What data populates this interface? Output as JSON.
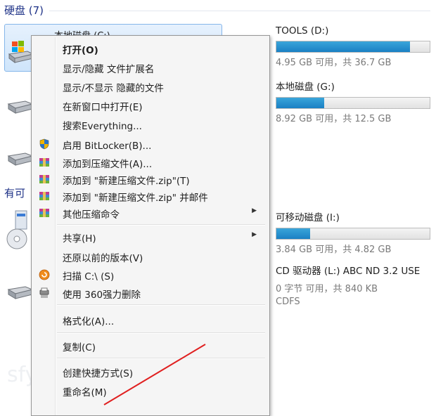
{
  "group_hard_drives": "硬盘 (7)",
  "group_removable_partial": "有可",
  "selected_drive": {
    "name": "本地磁盘 (C:)"
  },
  "drives": [
    {
      "name": "TOOLS (D:)",
      "free": "4.95 GB 可用，共 36.7 GB",
      "usage": 0.87
    },
    {
      "name": "本地磁盘 (G:)",
      "free": "8.92 GB 可用，共 12.5 GB",
      "usage": 0.31
    },
    {
      "name": "可移动磁盘 (I:)",
      "free": "3.84 GB 可用，共 4.82 GB",
      "usage": 0.22
    },
    {
      "name": "CD 驱动器 (L:) ABC ND 3.2 USE",
      "free": "0 字节 可用，共 840 KB",
      "fs": "CDFS"
    }
  ],
  "context_menu": {
    "open": "打开(O)",
    "toggle_ext": "显示/隐藏 文件扩展名",
    "toggle_hidden": "显示/不显示 隐藏的文件",
    "open_new_window": "在新窗口中打开(E)",
    "search_everything": "搜索Everything...",
    "bitlocker": "启用 BitLocker(B)...",
    "add_archive": "添加到压缩文件(A)...",
    "add_zip": "添加到 \"新建压缩文件.zip\"(T)",
    "add_zip_mail": "添加到 \"新建压缩文件.zip\" 并邮件",
    "other_compress": "其他压缩命令",
    "share": "共享(H)",
    "restore": "还原以前的版本(V)",
    "scan": "扫描 C:\\ (S)",
    "force_delete": "使用 360强力删除",
    "format": "格式化(A)...",
    "copy": "复制(C)",
    "create_shortcut": "创建快捷方式(S)",
    "rename": "重命名(M)"
  },
  "watermark": "sfyi"
}
